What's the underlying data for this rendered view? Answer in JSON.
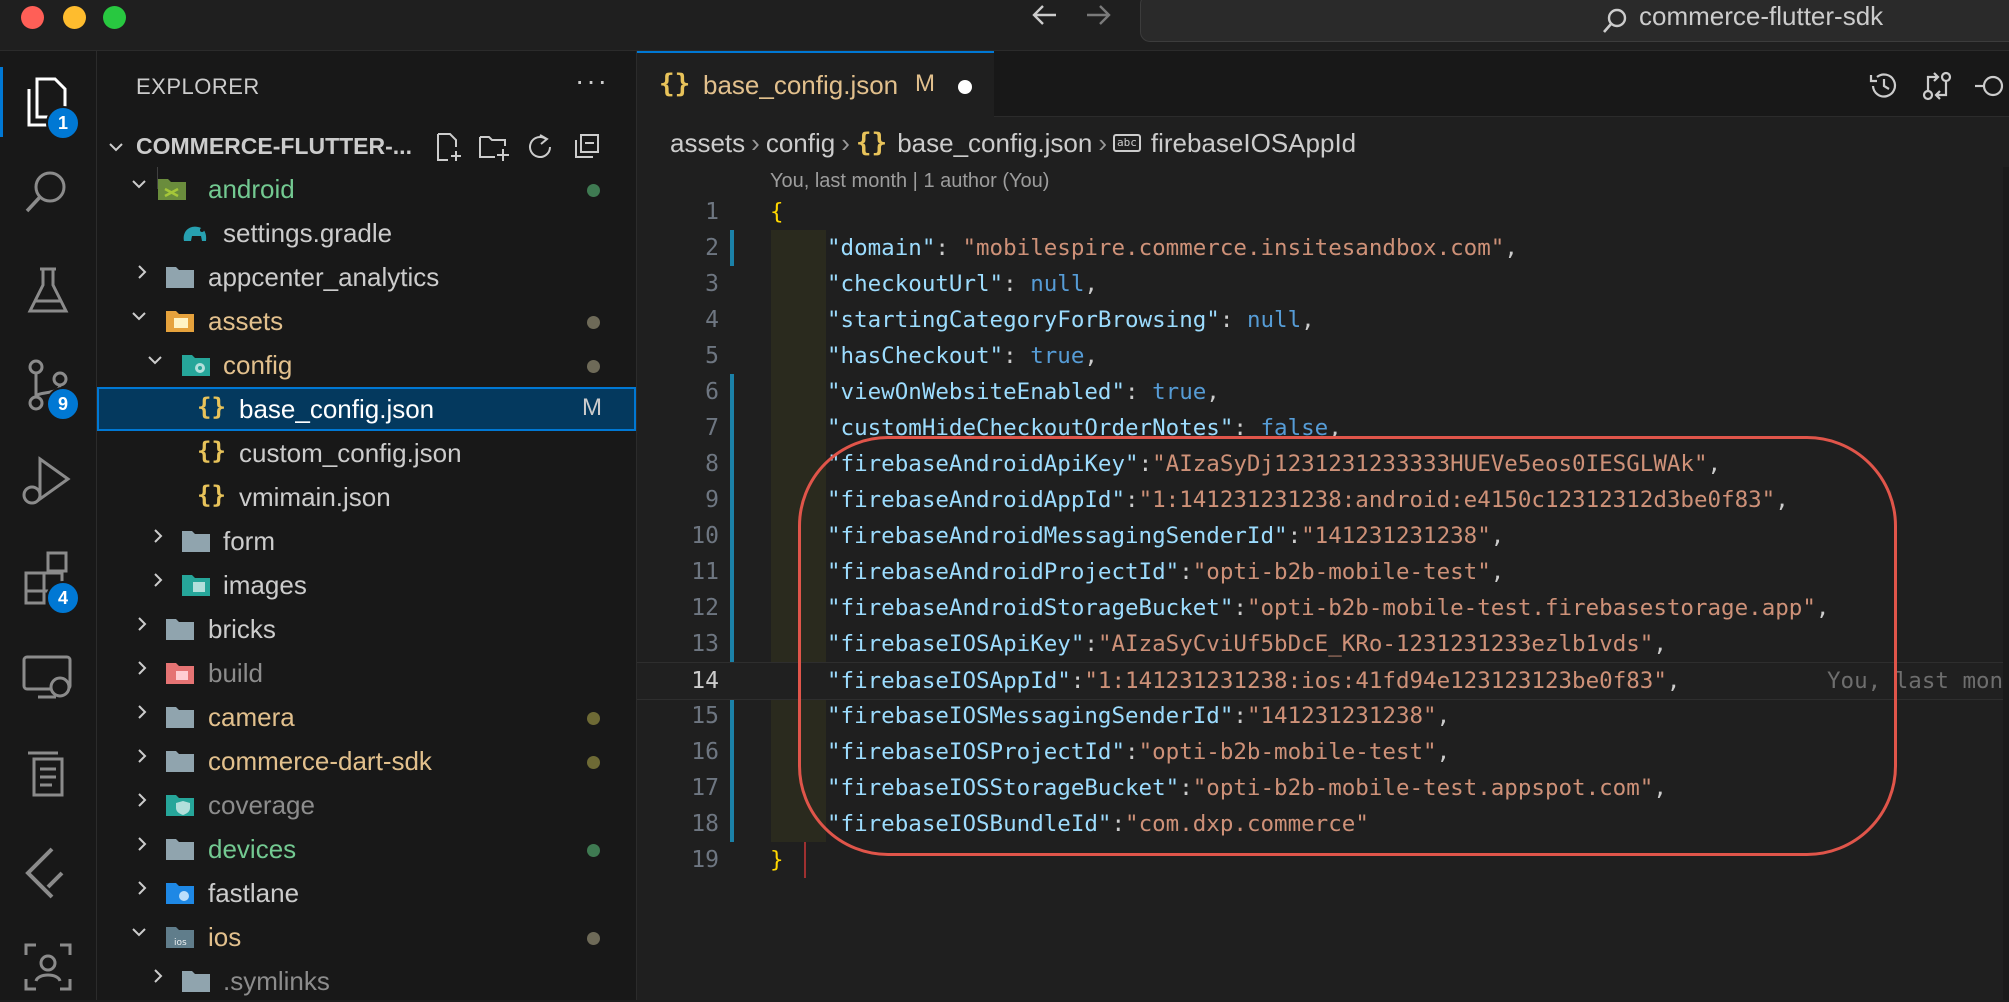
{
  "window": {
    "title": "commerce-flutter-sdk"
  },
  "activity": {
    "explorer_badge": "1",
    "scm_badge": "9",
    "extensions_badge": "4"
  },
  "sidebar": {
    "title": "EXPLORER",
    "more": "···",
    "section": "COMMERCE-FLUTTER-...",
    "tree": [
      {
        "label": "android",
        "color": "#73c991",
        "dot": "#3f7a52"
      },
      {
        "label": "settings.gradle",
        "color": "#cccccc"
      },
      {
        "label": "appcenter_analytics",
        "color": "#cccccc"
      },
      {
        "label": "assets",
        "color": "#e2c08d",
        "dot": "#6e6a58"
      },
      {
        "label": "config",
        "color": "#e2c08d",
        "dot": "#6e6a58"
      },
      {
        "label": "base_config.json",
        "color": "#ffffff",
        "mark": "M"
      },
      {
        "label": "custom_config.json",
        "color": "#cccccc"
      },
      {
        "label": "vmimain.json",
        "color": "#cccccc"
      },
      {
        "label": "form",
        "color": "#cccccc"
      },
      {
        "label": "images",
        "color": "#cccccc"
      },
      {
        "label": "bricks",
        "color": "#cccccc"
      },
      {
        "label": "build",
        "color": "#8c8c8c"
      },
      {
        "label": "camera",
        "color": "#e2c08d",
        "dot": "#6e6a35"
      },
      {
        "label": "commerce-dart-sdk",
        "color": "#e2c08d",
        "dot": "#6e6a35"
      },
      {
        "label": "coverage",
        "color": "#8c8c8c"
      },
      {
        "label": "devices",
        "color": "#73c991",
        "dot": "#3f7a52"
      },
      {
        "label": "fastlane",
        "color": "#cccccc"
      },
      {
        "label": "ios",
        "color": "#e2c08d",
        "dot": "#6e6a58"
      },
      {
        "label": ".symlinks",
        "color": "#8c8c8c"
      }
    ]
  },
  "editor": {
    "tab": {
      "label": "base_config.json",
      "modified": "M",
      "icon": "{}"
    },
    "breadcrumb": [
      "assets",
      "config",
      "base_config.json",
      "firebaseIOSAppId"
    ],
    "blame_top": "You, last month | 1 author (You)",
    "blame_inline": "You, last mon",
    "lines": [
      {
        "n": "1"
      },
      {
        "n": "2",
        "key": "\"domain\"",
        "sep": ": ",
        "val": "\"mobilespire.commerce.insitesandbox.com\"",
        "end": ","
      },
      {
        "n": "3",
        "key": "\"checkoutUrl\"",
        "sep": ": ",
        "val": "null",
        "end": ","
      },
      {
        "n": "4",
        "key": "\"startingCategoryForBrowsing\"",
        "sep": ": ",
        "val": "null",
        "end": ","
      },
      {
        "n": "5",
        "key": "\"hasCheckout\"",
        "sep": ": ",
        "val": "true",
        "end": ","
      },
      {
        "n": "6",
        "key": "\"viewOnWebsiteEnabled\"",
        "sep": ": ",
        "val": "true",
        "end": ","
      },
      {
        "n": "7",
        "key": "\"customHideCheckoutOrderNotes\"",
        "sep": ": ",
        "val": "false",
        "end": ","
      },
      {
        "n": "8",
        "key": "\"firebaseAndroidApiKey\"",
        "sep": ":",
        "val": "\"AIzaSyDj1231231233333HUEVe5eos0IESGLWAk\"",
        "end": ","
      },
      {
        "n": "9",
        "key": "\"firebaseAndroidAppId\"",
        "sep": ":",
        "val": "\"1:141231231238:android:e4150c12312312d3be0f83\"",
        "end": ","
      },
      {
        "n": "10",
        "key": "\"firebaseAndroidMessagingSenderId\"",
        "sep": ":",
        "val": "\"141231231238\"",
        "end": ","
      },
      {
        "n": "11",
        "key": "\"firebaseAndroidProjectId\"",
        "sep": ":",
        "val": "\"opti-b2b-mobile-test\"",
        "end": ","
      },
      {
        "n": "12",
        "key": "\"firebaseAndroidStorageBucket\"",
        "sep": ":",
        "val": "\"opti-b2b-mobile-test.firebasestorage.app\"",
        "end": ","
      },
      {
        "n": "13",
        "key": "\"firebaseIOSApiKey\"",
        "sep": ":",
        "val": "\"AIzaSyCviUf5bDcE_KRo-1231231233ezlb1vds\"",
        "end": ","
      },
      {
        "n": "14",
        "key": "\"firebaseIOSAppId\"",
        "sep": ":",
        "val": "\"1:141231231238:ios:41fd94e123123123be0f83\"",
        "end": ","
      },
      {
        "n": "15",
        "key": "\"firebaseIOSMessagingSenderId\"",
        "sep": ":",
        "val": "\"141231231238\"",
        "end": ","
      },
      {
        "n": "16",
        "key": "\"firebaseIOSProjectId\"",
        "sep": ":",
        "val": "\"opti-b2b-mobile-test\"",
        "end": ","
      },
      {
        "n": "17",
        "key": "\"firebaseIOSStorageBucket\"",
        "sep": ":",
        "val": "\"opti-b2b-mobile-test.appspot.com\"",
        "end": ","
      },
      {
        "n": "18",
        "key": "\"firebaseIOSBundleId\"",
        "sep": ":",
        "val": "\"com.dxp.commerce\"",
        "end": ""
      },
      {
        "n": "19"
      }
    ],
    "brace_open": "{",
    "brace_close": "}"
  }
}
